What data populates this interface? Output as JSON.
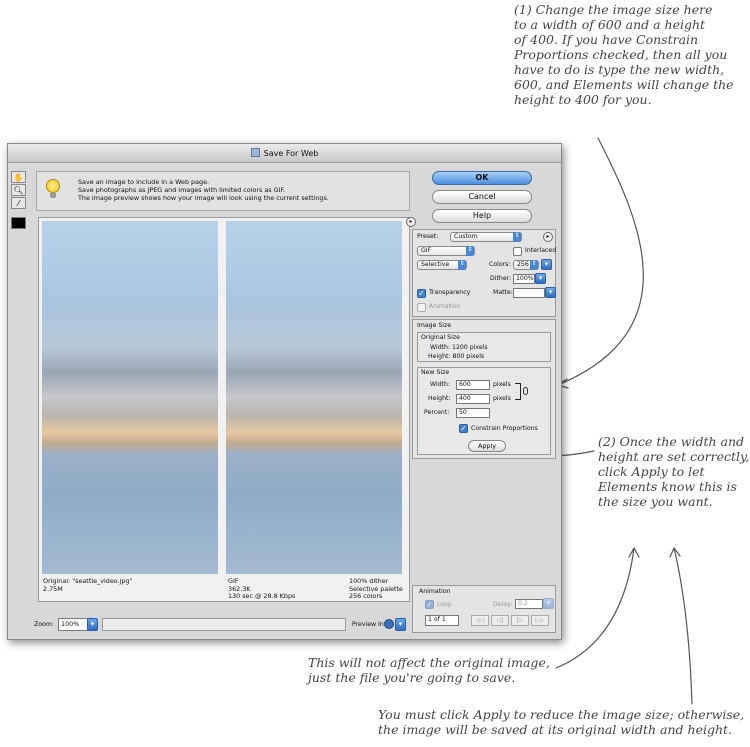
{
  "window": {
    "title": "Save For Web",
    "info_lines": [
      "Save an image to include in a Web page.",
      "Save photographs as JPEG and images with limited colors as GIF.",
      "The image preview shows how your image will look using the current settings."
    ],
    "tools": [
      "hand-icon",
      "zoom-icon",
      "eyedropper-icon",
      "color-swatch"
    ]
  },
  "buttons": {
    "ok": "OK",
    "cancel": "Cancel",
    "help": "Help"
  },
  "settings": {
    "preset_label": "Preset:",
    "preset_value": "Custom",
    "format": "GIF",
    "interlaced_label": "Interlaced",
    "reduction": "Selective",
    "colors_label": "Colors:",
    "colors_value": "256",
    "dither_label": "Dither:",
    "dither_value": "100%",
    "transparency_label": "Transparency",
    "matte_label": "Matte:",
    "animation_label": "Animation"
  },
  "image_size": {
    "group_label": "Image Size",
    "original_label": "Original Size",
    "orig_width": "Width:  1200 pixels",
    "orig_height": "Height:  800 pixels",
    "new_label": "New Size",
    "width_label": "Width:",
    "width_value": "600",
    "height_label": "Height:",
    "height_value": "400",
    "units": "pixels",
    "percent_label": "Percent:",
    "percent_value": "50",
    "constrain_label": "Constrain Proportions",
    "apply_label": "Apply"
  },
  "animation": {
    "group_label": "Animation",
    "loop_label": "Loop",
    "delay_label": "Delay:",
    "delay_value": "0.2",
    "frame_value": "1 of 1",
    "nav": [
      "◁◁",
      "◁|",
      "|▷",
      "▷▷"
    ]
  },
  "preview": {
    "left_caption": [
      "Original: \"seattle_video.jpg\"",
      "2.75M"
    ],
    "right_caption_left": [
      "GIF",
      "362.3K",
      "130 sec @ 28.8 Kbps"
    ],
    "right_caption_right": [
      "100% dither",
      "Selective palette",
      "256 colors"
    ],
    "zoom_label": "Zoom:",
    "zoom_value": "100%",
    "preview_in_label": "Preview In:"
  },
  "annotations": {
    "note1": "(1) Change the image size here\nto a width of 600 and a height\nof 400. If you have Constrain\nProportions checked, then all you\nhave to do is type the new width,\n600, and Elements will change the\nheight to 400 for you.",
    "note2": "(2) Once the width and\nheight are set correctly,\nclick Apply to let\nElements know this is\nthe size you want.",
    "note3": "This will not affect the original image,\njust the file you're going to save.",
    "note4": "You must click Apply to reduce the image size; otherwise,\nthe image will be saved at its original width and height."
  }
}
